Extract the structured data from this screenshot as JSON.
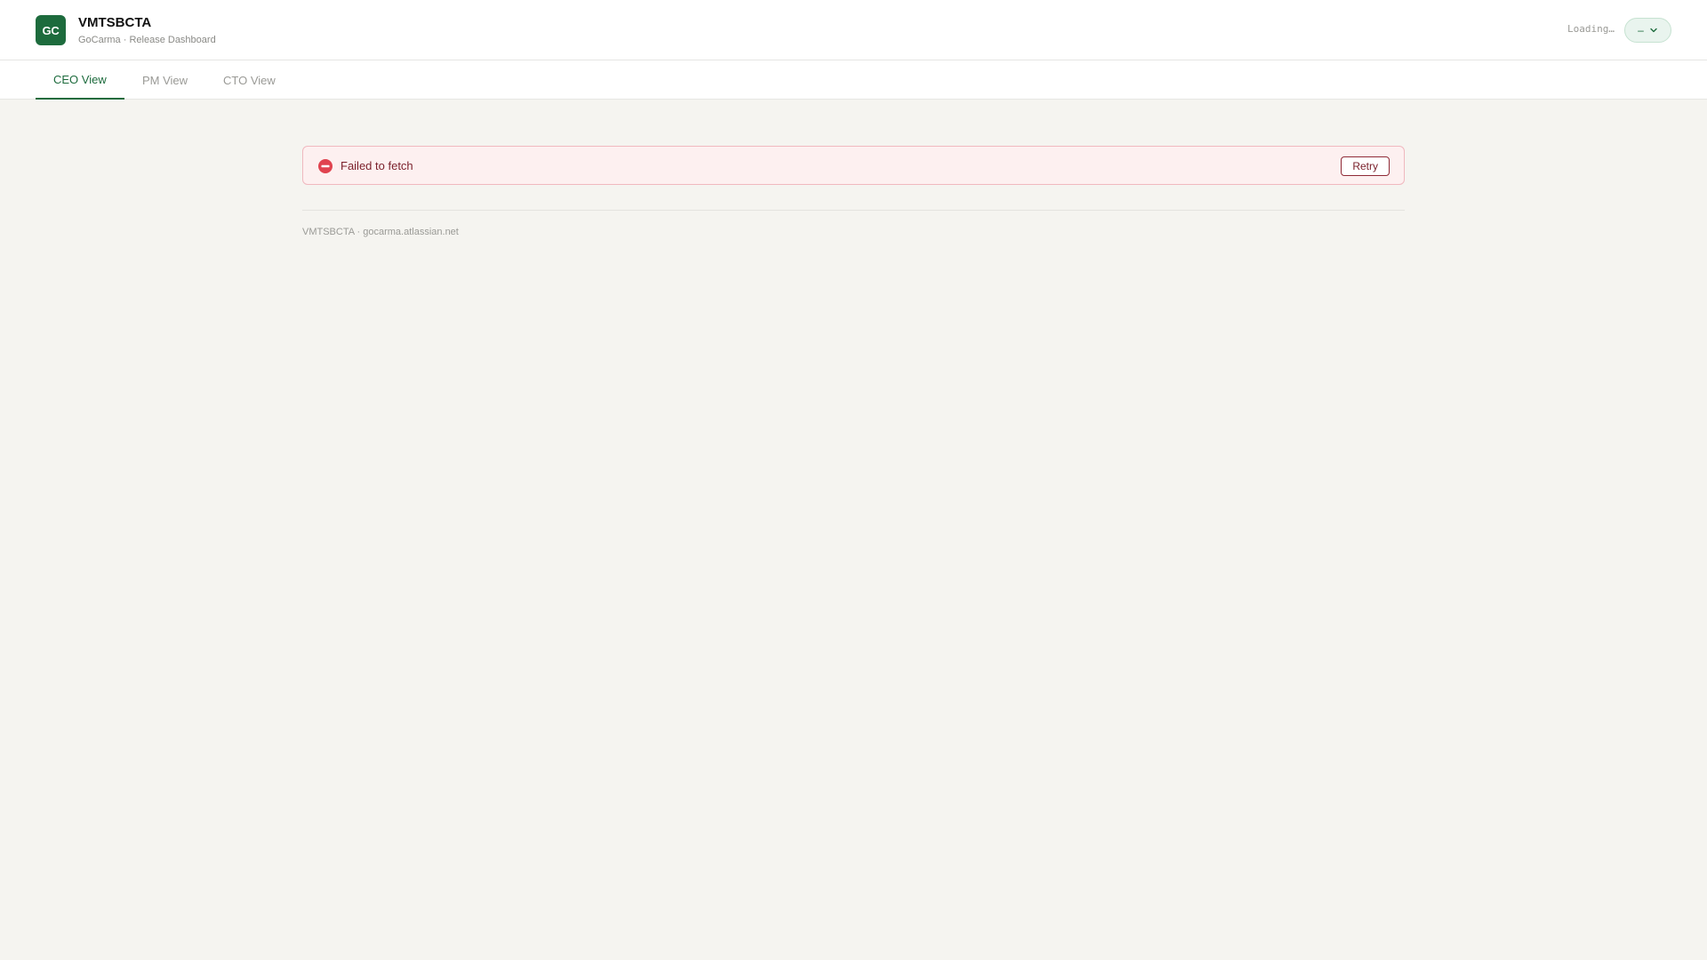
{
  "header": {
    "logo_text": "GC",
    "title": "VMTSBCTA",
    "subtitle": "GoCarma · Release Dashboard",
    "status_text": "Loading…",
    "selector_value": "–",
    "selector_icon": "chevron-down-icon"
  },
  "tabs": [
    {
      "label": "CEO View",
      "active": true
    },
    {
      "label": "PM View",
      "active": false
    },
    {
      "label": "CTO View",
      "active": false
    }
  ],
  "error": {
    "icon": "error-stop-icon",
    "message": "Failed to fetch",
    "retry_label": "Retry"
  },
  "footer": {
    "text": "VMTSBCTA · gocarma.atlassian.net"
  },
  "colors": {
    "brand": "#1d6b3d",
    "error_bg": "#fdf0f0",
    "error_border": "#f0b8bf",
    "error_icon": "#e0434f",
    "page_bg": "#f5f4f0"
  }
}
